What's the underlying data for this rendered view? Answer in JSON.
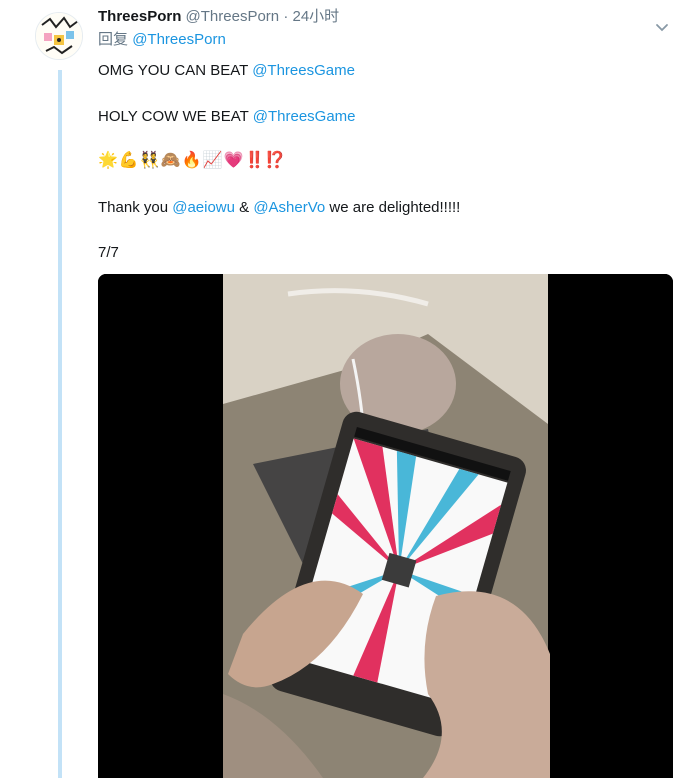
{
  "tweet": {
    "display_name": "ThreesPorn",
    "handle": "@ThreesPorn",
    "separator": "·",
    "time": "24小时",
    "reply_prefix": "回复",
    "reply_to": "@ThreesPorn",
    "lines": {
      "l1_text": "OMG YOU CAN BEAT ",
      "l1_mention": "@ThreesGame",
      "l2_text": "HOLY COW WE BEAT ",
      "l2_mention": "@ThreesGame",
      "emoji": "🌟💪👯🙈🔥📈💗",
      "emoji_exclaim": "‼️⁉️",
      "l4_text1": "Thank you ",
      "l4_mention1": "@aeiowu",
      "l4_text2": " & ",
      "l4_mention2": "@AsherVo",
      "l4_text3": " we are delighted!!!!!",
      "counter": "7/7"
    }
  },
  "colors": {
    "link": "#1b95e0",
    "muted": "#657786",
    "thread_line": "#c3e2f7",
    "alert_red": "#e0245e"
  },
  "icons": {
    "caret": "chevron-down-icon",
    "media": "video-thumbnail"
  }
}
